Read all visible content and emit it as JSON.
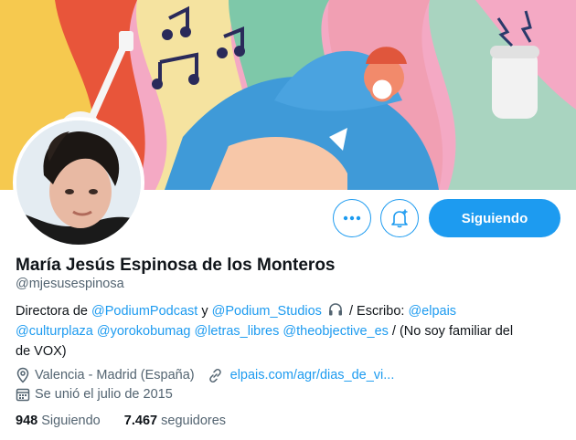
{
  "profile": {
    "name": "María Jesús Espinosa de los Monteros",
    "handle": "@mjesusespinosa",
    "bio": {
      "line1_prefix": "Directora de ",
      "mention_podium_podcast": "@PodiumPodcast",
      "line1_y": " y ",
      "mention_podium_studios": "@Podium_Studios",
      "line1_suffix": " / Escribo: ",
      "mention_elpais": "@elpais",
      "mention_culturplaza": "@culturplaza",
      "mention_yorokobumag": "@yorokobumag",
      "mention_letras_libres": "@letras_libres",
      "mention_theobjective": "@theobjective_es",
      "line2_suffix": " / (No soy familiar del",
      "line3": "de VOX)"
    },
    "location": "Valencia - Madrid (España)",
    "website": "elpais.com/agr/dias_de_vi...",
    "joined": "Se unió el julio de 2015",
    "following_count": "948",
    "following_label": "Siguiendo",
    "followers_count": "7.467",
    "followers_label": "seguidores"
  },
  "actions": {
    "more_icon": "ellipsis-icon",
    "notify_icon": "bell-plus-icon",
    "follow_label": "Siguiendo"
  },
  "colors": {
    "accent": "#1d9bf0",
    "text": "#0f1419",
    "secondary": "#536471"
  }
}
